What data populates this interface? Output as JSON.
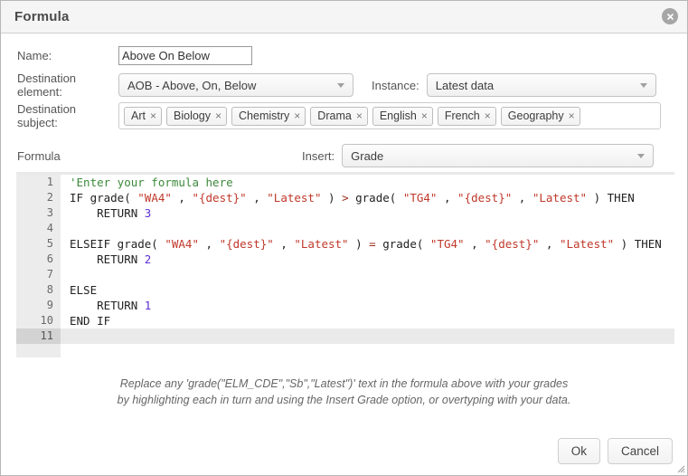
{
  "window": {
    "title": "Formula",
    "close_icon": "close-circle-icon"
  },
  "form": {
    "name_label": "Name:",
    "name_value": "Above On Below",
    "name_placeholder": "",
    "destination_element_label": "Destination element:",
    "destination_element_value": "AOB - Above, On, Below",
    "instance_label": "Instance:",
    "instance_value": "Latest data",
    "destination_subject_label": "Destination subject:",
    "subjects": [
      {
        "label": "Art",
        "remove": "×"
      },
      {
        "label": "Biology",
        "remove": "×"
      },
      {
        "label": "Chemistry",
        "remove": "×"
      },
      {
        "label": "Drama",
        "remove": "×"
      },
      {
        "label": "English",
        "remove": "×"
      },
      {
        "label": "French",
        "remove": "×"
      },
      {
        "label": "Geography",
        "remove": "×"
      }
    ]
  },
  "formula": {
    "label": "Formula",
    "insert_label": "Insert:",
    "insert_value": "Grade",
    "active_line": 11,
    "gutter": [
      "1",
      "2",
      "3",
      "4",
      "5",
      "6",
      "7",
      "8",
      "9",
      "10",
      "11"
    ],
    "lines": [
      {
        "n": "1",
        "tokens": [
          {
            "t": "comment",
            "v": "'Enter your formula here"
          }
        ]
      },
      {
        "n": "2",
        "tokens": [
          {
            "t": "plain",
            "v": "IF grade( "
          },
          {
            "t": "string",
            "v": "\"WA4\""
          },
          {
            "t": "plain",
            "v": " , "
          },
          {
            "t": "string",
            "v": "\"{dest}\""
          },
          {
            "t": "plain",
            "v": " , "
          },
          {
            "t": "string",
            "v": "\"Latest\""
          },
          {
            "t": "plain",
            "v": " ) "
          },
          {
            "t": "op",
            "v": ">"
          },
          {
            "t": "plain",
            "v": " grade( "
          },
          {
            "t": "string",
            "v": "\"TG4\""
          },
          {
            "t": "plain",
            "v": " , "
          },
          {
            "t": "string",
            "v": "\"{dest}\""
          },
          {
            "t": "plain",
            "v": " , "
          },
          {
            "t": "string",
            "v": "\"Latest\""
          },
          {
            "t": "plain",
            "v": " ) THEN"
          }
        ]
      },
      {
        "n": "3",
        "tokens": [
          {
            "t": "plain",
            "v": "    RETURN "
          },
          {
            "t": "number",
            "v": "3"
          }
        ]
      },
      {
        "n": "4",
        "tokens": []
      },
      {
        "n": "5",
        "tokens": [
          {
            "t": "plain",
            "v": "ELSEIF grade( "
          },
          {
            "t": "string",
            "v": "\"WA4\""
          },
          {
            "t": "plain",
            "v": " , "
          },
          {
            "t": "string",
            "v": "\"{dest}\""
          },
          {
            "t": "plain",
            "v": " , "
          },
          {
            "t": "string",
            "v": "\"Latest\""
          },
          {
            "t": "plain",
            "v": " ) "
          },
          {
            "t": "op",
            "v": "="
          },
          {
            "t": "plain",
            "v": " grade( "
          },
          {
            "t": "string",
            "v": "\"TG4\""
          },
          {
            "t": "plain",
            "v": " , "
          },
          {
            "t": "string",
            "v": "\"{dest}\""
          },
          {
            "t": "plain",
            "v": " , "
          },
          {
            "t": "string",
            "v": "\"Latest\""
          },
          {
            "t": "plain",
            "v": " ) THEN"
          }
        ]
      },
      {
        "n": "6",
        "tokens": [
          {
            "t": "plain",
            "v": "    RETURN "
          },
          {
            "t": "number",
            "v": "2"
          }
        ]
      },
      {
        "n": "7",
        "tokens": []
      },
      {
        "n": "8",
        "tokens": [
          {
            "t": "plain",
            "v": "ELSE"
          }
        ]
      },
      {
        "n": "9",
        "tokens": [
          {
            "t": "plain",
            "v": "    RETURN "
          },
          {
            "t": "number",
            "v": "1"
          }
        ]
      },
      {
        "n": "10",
        "tokens": [
          {
            "t": "plain",
            "v": "END IF"
          }
        ]
      },
      {
        "n": "11",
        "tokens": []
      }
    ]
  },
  "hint": {
    "line1": "Replace any 'grade(\"ELM_CDE\",\"Sb\",\"Latest\")' text in the formula above with your grades",
    "line2": "by highlighting each in turn and using the Insert Grade option, or overtyping with your data."
  },
  "footer": {
    "ok_label": "Ok",
    "cancel_label": "Cancel"
  },
  "colors": {
    "titlebar_bg": "#f5f5f5",
    "comment": "#3c8a3c",
    "string": "#c0392b",
    "number": "#5b2fd6",
    "operator": "#9b2d1f",
    "gutter_bg": "#ececec",
    "active_line_bg": "#eaeaea"
  }
}
